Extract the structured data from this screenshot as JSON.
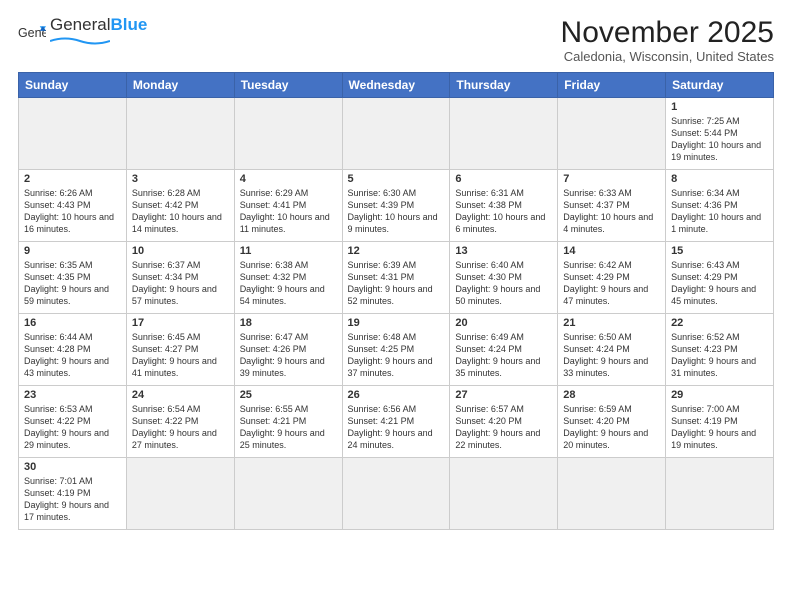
{
  "header": {
    "logo_general": "General",
    "logo_blue": "Blue",
    "month_title": "November 2025",
    "location": "Caledonia, Wisconsin, United States"
  },
  "days_of_week": [
    "Sunday",
    "Monday",
    "Tuesday",
    "Wednesday",
    "Thursday",
    "Friday",
    "Saturday"
  ],
  "weeks": [
    [
      {
        "day": "",
        "info": ""
      },
      {
        "day": "",
        "info": ""
      },
      {
        "day": "",
        "info": ""
      },
      {
        "day": "",
        "info": ""
      },
      {
        "day": "",
        "info": ""
      },
      {
        "day": "",
        "info": ""
      },
      {
        "day": "1",
        "info": "Sunrise: 7:25 AM\nSunset: 5:44 PM\nDaylight: 10 hours and 19 minutes."
      }
    ],
    [
      {
        "day": "2",
        "info": "Sunrise: 6:26 AM\nSunset: 4:43 PM\nDaylight: 10 hours and 16 minutes."
      },
      {
        "day": "3",
        "info": "Sunrise: 6:28 AM\nSunset: 4:42 PM\nDaylight: 10 hours and 14 minutes."
      },
      {
        "day": "4",
        "info": "Sunrise: 6:29 AM\nSunset: 4:41 PM\nDaylight: 10 hours and 11 minutes."
      },
      {
        "day": "5",
        "info": "Sunrise: 6:30 AM\nSunset: 4:39 PM\nDaylight: 10 hours and 9 minutes."
      },
      {
        "day": "6",
        "info": "Sunrise: 6:31 AM\nSunset: 4:38 PM\nDaylight: 10 hours and 6 minutes."
      },
      {
        "day": "7",
        "info": "Sunrise: 6:33 AM\nSunset: 4:37 PM\nDaylight: 10 hours and 4 minutes."
      },
      {
        "day": "8",
        "info": "Sunrise: 6:34 AM\nSunset: 4:36 PM\nDaylight: 10 hours and 1 minute."
      }
    ],
    [
      {
        "day": "9",
        "info": "Sunrise: 6:35 AM\nSunset: 4:35 PM\nDaylight: 9 hours and 59 minutes."
      },
      {
        "day": "10",
        "info": "Sunrise: 6:37 AM\nSunset: 4:34 PM\nDaylight: 9 hours and 57 minutes."
      },
      {
        "day": "11",
        "info": "Sunrise: 6:38 AM\nSunset: 4:32 PM\nDaylight: 9 hours and 54 minutes."
      },
      {
        "day": "12",
        "info": "Sunrise: 6:39 AM\nSunset: 4:31 PM\nDaylight: 9 hours and 52 minutes."
      },
      {
        "day": "13",
        "info": "Sunrise: 6:40 AM\nSunset: 4:30 PM\nDaylight: 9 hours and 50 minutes."
      },
      {
        "day": "14",
        "info": "Sunrise: 6:42 AM\nSunset: 4:29 PM\nDaylight: 9 hours and 47 minutes."
      },
      {
        "day": "15",
        "info": "Sunrise: 6:43 AM\nSunset: 4:29 PM\nDaylight: 9 hours and 45 minutes."
      }
    ],
    [
      {
        "day": "16",
        "info": "Sunrise: 6:44 AM\nSunset: 4:28 PM\nDaylight: 9 hours and 43 minutes."
      },
      {
        "day": "17",
        "info": "Sunrise: 6:45 AM\nSunset: 4:27 PM\nDaylight: 9 hours and 41 minutes."
      },
      {
        "day": "18",
        "info": "Sunrise: 6:47 AM\nSunset: 4:26 PM\nDaylight: 9 hours and 39 minutes."
      },
      {
        "day": "19",
        "info": "Sunrise: 6:48 AM\nSunset: 4:25 PM\nDaylight: 9 hours and 37 minutes."
      },
      {
        "day": "20",
        "info": "Sunrise: 6:49 AM\nSunset: 4:24 PM\nDaylight: 9 hours and 35 minutes."
      },
      {
        "day": "21",
        "info": "Sunrise: 6:50 AM\nSunset: 4:24 PM\nDaylight: 9 hours and 33 minutes."
      },
      {
        "day": "22",
        "info": "Sunrise: 6:52 AM\nSunset: 4:23 PM\nDaylight: 9 hours and 31 minutes."
      }
    ],
    [
      {
        "day": "23",
        "info": "Sunrise: 6:53 AM\nSunset: 4:22 PM\nDaylight: 9 hours and 29 minutes."
      },
      {
        "day": "24",
        "info": "Sunrise: 6:54 AM\nSunset: 4:22 PM\nDaylight: 9 hours and 27 minutes."
      },
      {
        "day": "25",
        "info": "Sunrise: 6:55 AM\nSunset: 4:21 PM\nDaylight: 9 hours and 25 minutes."
      },
      {
        "day": "26",
        "info": "Sunrise: 6:56 AM\nSunset: 4:21 PM\nDaylight: 9 hours and 24 minutes."
      },
      {
        "day": "27",
        "info": "Sunrise: 6:57 AM\nSunset: 4:20 PM\nDaylight: 9 hours and 22 minutes."
      },
      {
        "day": "28",
        "info": "Sunrise: 6:59 AM\nSunset: 4:20 PM\nDaylight: 9 hours and 20 minutes."
      },
      {
        "day": "29",
        "info": "Sunrise: 7:00 AM\nSunset: 4:19 PM\nDaylight: 9 hours and 19 minutes."
      }
    ],
    [
      {
        "day": "30",
        "info": "Sunrise: 7:01 AM\nSunset: 4:19 PM\nDaylight: 9 hours and 17 minutes."
      },
      {
        "day": "",
        "info": ""
      },
      {
        "day": "",
        "info": ""
      },
      {
        "day": "",
        "info": ""
      },
      {
        "day": "",
        "info": ""
      },
      {
        "day": "",
        "info": ""
      },
      {
        "day": "",
        "info": ""
      }
    ]
  ]
}
